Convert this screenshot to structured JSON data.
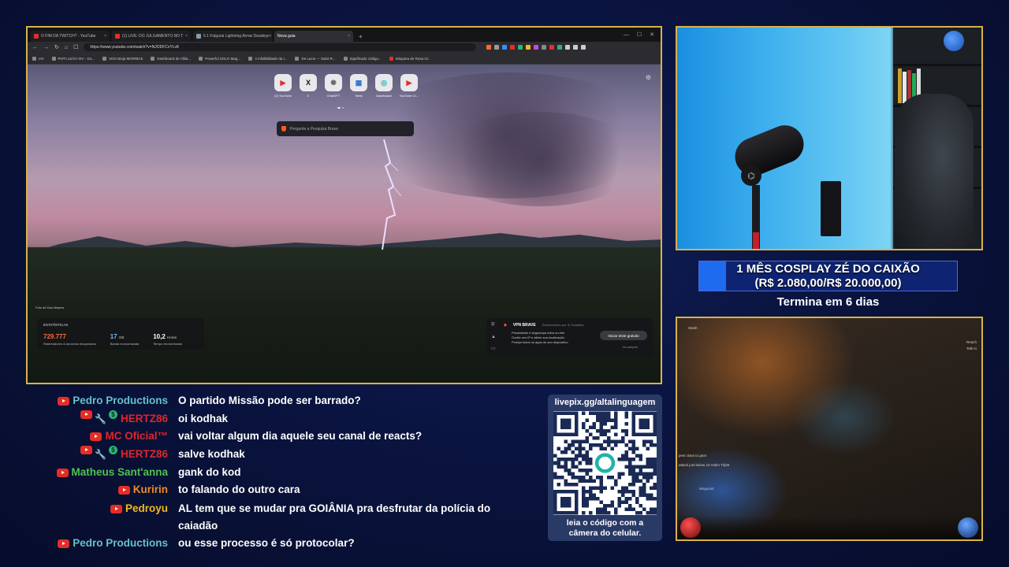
{
  "browser": {
    "tabs": [
      {
        "label": "O FIM DA TWITCH? - YouTube",
        "active": false
      },
      {
        "label": "(1) LIVE: DO JULGAMENTO NO T",
        "active": false
      },
      {
        "label": "6.1 Fulgurai Lightning Arrow Deadeye",
        "active": false
      },
      {
        "label": "Nova guia",
        "active": true
      }
    ],
    "new_tab_label": "+",
    "url": "https://www.youtube.com/watch?v=NJODFCvYLv8",
    "bookmarks": [
      "IAs",
      "PAPA LEÃO XIV - Go...",
      "VDO.Ninja MIORBAS",
      "Dashboard de Afilia...",
      "Powerful SOLO Mag...",
      "A infalibilidade da I...",
      "De Lacis — Saint R...",
      "Significado código...",
      "Máquina de Rosa Gi..."
    ],
    "shortcuts": [
      {
        "label": "(2) YouTube",
        "glyph": "▶",
        "color": "#e52d27"
      },
      {
        "label": "X",
        "glyph": "X",
        "color": "#111111"
      },
      {
        "label": "ChatGPT",
        "glyph": "✺",
        "color": "#6b6b6b"
      },
      {
        "label": "Tetris",
        "glyph": "▦",
        "color": "#2a6fd6"
      },
      {
        "label": "Dashboard",
        "glyph": "◎",
        "color": "#1fb5a8"
      },
      {
        "label": "YouTube Cr...",
        "glyph": "▶",
        "color": "#e52d27"
      }
    ],
    "search_placeholder": "Pergunte a Pesquisa Brave",
    "photo_credit": "Foto de Dan Meyers",
    "stats": {
      "title": "ESTATÍSTICAS",
      "items": [
        {
          "value": "729.777",
          "unit": "",
          "label": "Rastreadores & anúncios bloqueados",
          "color": "#ff6a3d"
        },
        {
          "value": "17",
          "unit": "GB",
          "label": "Banda economizada",
          "color": "#7fb0ff"
        },
        {
          "value": "10,2",
          "unit": "Horas",
          "label": "Tempo economizado",
          "color": "#ffffff"
        }
      ]
    },
    "vpn": {
      "title": "VPN BRAVE",
      "subtitle": "Desenvolvido por ◎ Guardian",
      "items": [
        "Privacidade e segurança extra on-line",
        "Oculte seu IP e altere sua localização",
        "Proteja todos os apps do seu dispositivo"
      ],
      "button": "Iniciar teste gratuito",
      "link": "Já comprei"
    }
  },
  "goal": {
    "line1": "1 MÊS COSPLAY ZÉ DO CAIXÃO",
    "line2": "(R$ 2.080,00/R$ 20.000,00)",
    "progress": 0.104,
    "ends": "Termina em 6 dias"
  },
  "game": {
    "labels": [
      "Stash",
      "Reach",
      "Talk to",
      "pest class to gear",
      "attack just below 10 realm Trij65",
      "Waypoint"
    ]
  },
  "chat": [
    {
      "user": "Pedro Productions",
      "color": "#67c0c9",
      "mod": false,
      "donor": false,
      "text": "O partido Missão pode ser barrado?"
    },
    {
      "user": "HERTZ86",
      "color": "#e0242b",
      "mod": true,
      "donor": true,
      "text": "oi kodhak"
    },
    {
      "user": "MC Oficial™",
      "color": "#e0242b",
      "mod": false,
      "donor": false,
      "text": "vai voltar algum dia aquele seu canal de reacts?"
    },
    {
      "user": "HERTZ86",
      "color": "#e0242b",
      "mod": true,
      "donor": true,
      "text": "salve kodhak"
    },
    {
      "user": "Matheus Sant'anna",
      "color": "#4fc24f",
      "mod": false,
      "donor": false,
      "text": "gank do kod"
    },
    {
      "user": "Kuririn",
      "color": "#f28a2a",
      "mod": false,
      "donor": false,
      "text": "to falando do outro cara"
    },
    {
      "user": "Pedroyu",
      "color": "#f2b820",
      "mod": false,
      "donor": false,
      "text": "AL tem que se mudar pra GOIÂNIA pra desfrutar da polícia do",
      "text2": "caiadão"
    },
    {
      "user": "Pedro Productions",
      "color": "#67c0c9",
      "mod": false,
      "donor": false,
      "text": "ou esse processo é só protocolar?"
    }
  ],
  "qr": {
    "url": "livepix.gg/altalinguagem",
    "caption1": "leia o código com a",
    "caption2": "câmera do celular."
  }
}
